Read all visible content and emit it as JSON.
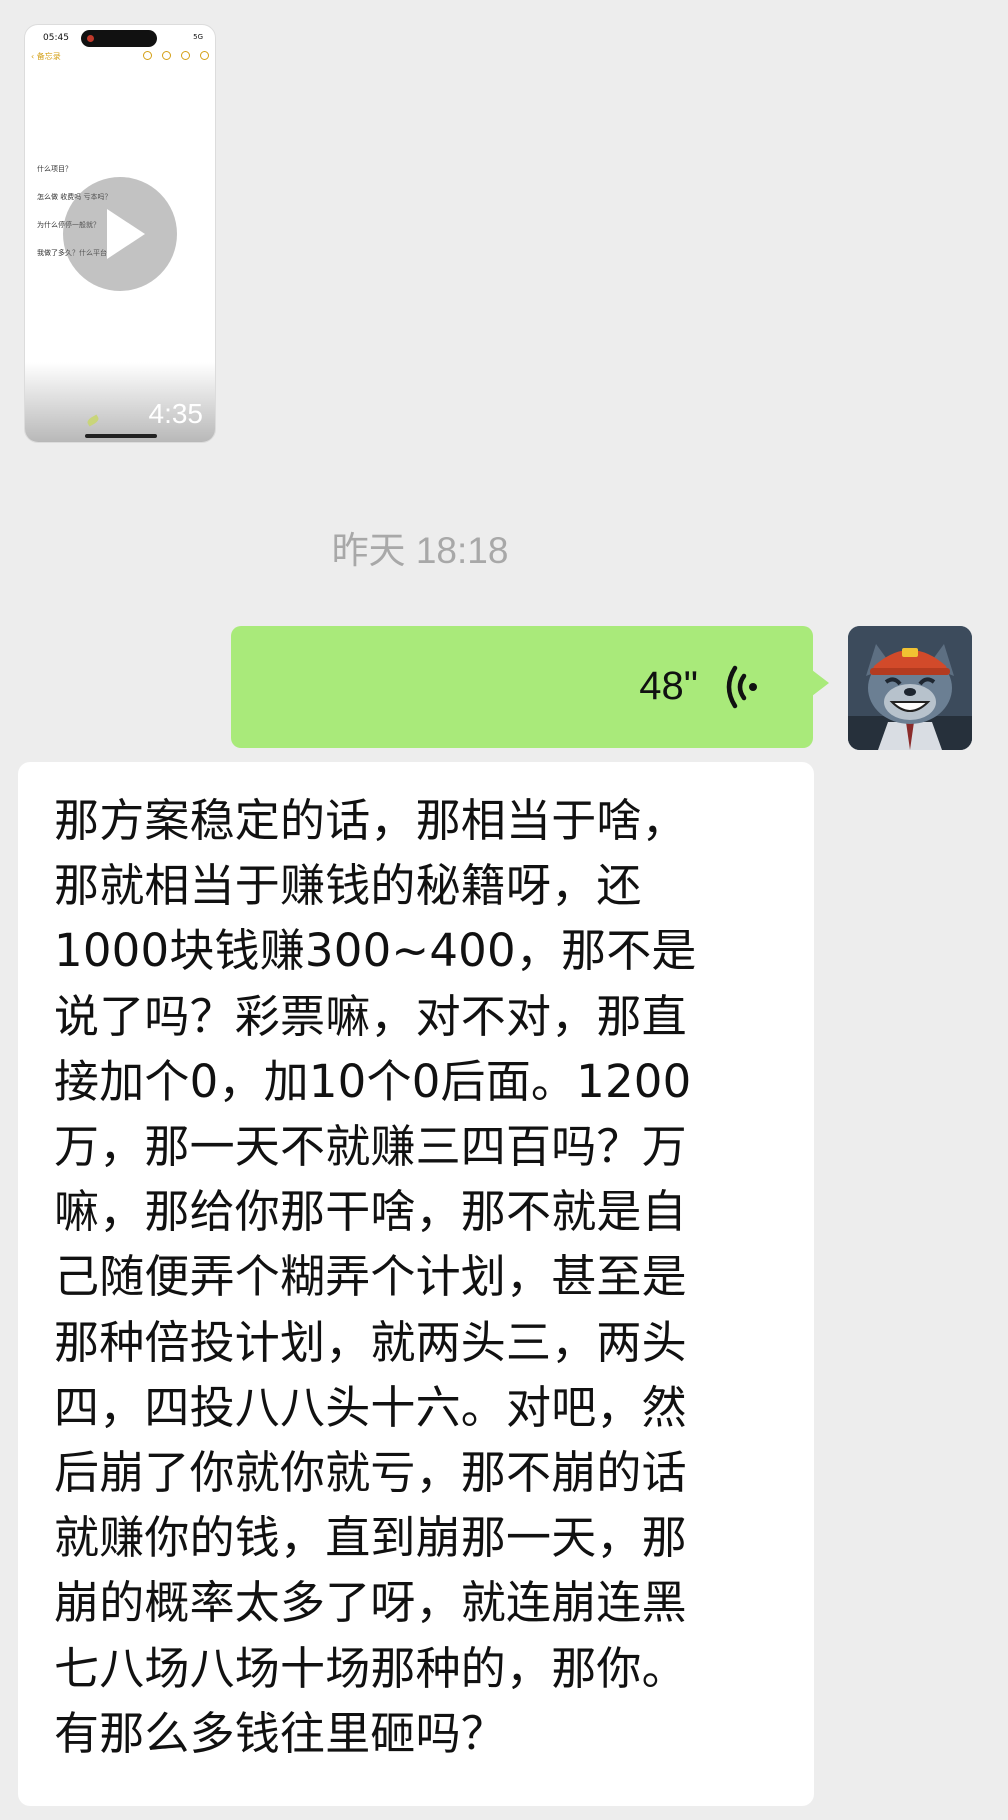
{
  "video": {
    "status_time": "05:45",
    "status_signal": "5G",
    "back_label": "备忘录",
    "note_lines": [
      "什么项目？",
      "怎么做 收费吗 亏本吗？",
      "为什么停停一般就？",
      "我做了多久？什么平台"
    ],
    "duration": "4:35",
    "icons": [
      "play-icon"
    ]
  },
  "timestamp": "昨天 18:18",
  "voice_message": {
    "duration": "48\"",
    "icon": "voice-wave-icon",
    "bubble_color": "#a9ea7a"
  },
  "avatar": {
    "icon": "cartoon-wolf-avatar"
  },
  "text_message": {
    "lines": [
      "那方案稳定的话，那相当于啥，",
      "那就相当于赚钱的秘籍呀，还",
      "1000块钱赚300~400，那不是",
      "说了吗？彩票嘛，对不对，那直",
      "接加个0，加10个0后面。1200",
      "万，那一天不就赚三四百吗？万",
      "嘛，那给你那干啥，那不就是自",
      "己随便弄个糊弄个计划，甚至是",
      "那种倍投计划，就两头三，两头",
      "四，四投八八头十六。对吧，然",
      "后崩了你就你就亏，那不崩的话",
      "就赚你的钱，直到崩那一天，那",
      "崩的概率太多了呀，就连崩连黑",
      "七八场八场十场那种的，那你。",
      "有那么多钱往里砸吗？"
    ]
  },
  "colors": {
    "background": "#ededed",
    "bubble_self": "#a9ea7a",
    "bubble_other": "#ffffff",
    "timestamp": "#a8a8a8"
  }
}
